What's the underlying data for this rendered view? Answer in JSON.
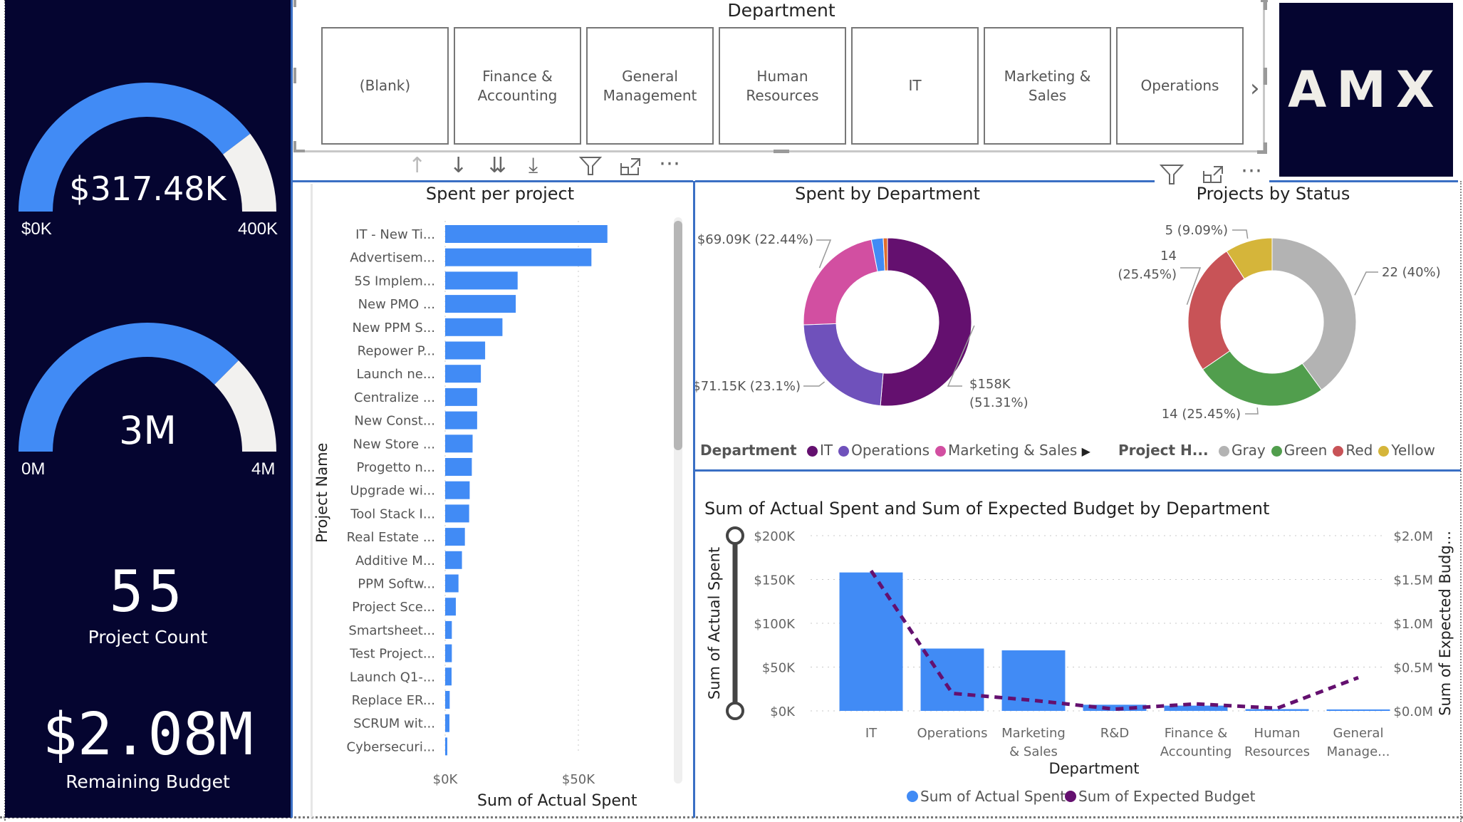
{
  "kpis": {
    "gauge_spent": {
      "value_label": "$317.48K",
      "min_label": "$0K",
      "max_label": "400K",
      "value": 317.48,
      "min": 0,
      "max": 400,
      "fill_color": "#418bf5",
      "track_color": "#f2f1ef"
    },
    "gauge_budget": {
      "value_label": "3M",
      "min_label": "0M",
      "max_label": "4M",
      "value": 3,
      "min": 0,
      "max": 4,
      "fill_color": "#418bf5",
      "track_color": "#f2f1ef"
    },
    "project_count": {
      "value": "55",
      "label": "Project Count"
    },
    "remaining_budget": {
      "value": "$2.08M",
      "label": "Remaining Budget"
    }
  },
  "slicer": {
    "title": "Department",
    "tiles": [
      "(Blank)",
      "Finance & Accounting",
      "General Management",
      "Human Resources",
      "IT",
      "Marketing & Sales",
      "Operations"
    ],
    "next_icon": "chevron-right-icon"
  },
  "visual_header_icons": {
    "drill_up": "↑",
    "drill_down": "↓",
    "expand_all": "⇊",
    "expand_next": "⤓",
    "filter": "⛛",
    "focus": "⤢",
    "more": "⋯"
  },
  "logo": {
    "text": "AMX"
  },
  "chart_data": [
    {
      "type": "bar",
      "orientation": "horizontal",
      "title": "Spent per project",
      "xlabel": "Sum of Actual Spent",
      "ylabel": "Project Name",
      "xlim": [
        0,
        75000
      ],
      "xticks": [
        {
          "value": 0,
          "label": "$0K"
        },
        {
          "value": 50000,
          "label": "$50K"
        }
      ],
      "grid": true,
      "color": "#418bf5",
      "categories": [
        "IT - New Ti...",
        "Advertisem...",
        "5S Implem...",
        "New PMO ...",
        "New PPM S...",
        "Repower P...",
        "Launch ne...",
        "Centralize ...",
        "New Const...",
        "New Store ...",
        "Progetto n...",
        "Upgrade wi...",
        "Tool Stack I...",
        "Real Estate ...",
        "Additive M...",
        "PPM Softw...",
        "Project Sce...",
        "Smartsheet...",
        "Test Project...",
        "Launch Q1-...",
        "Replace ER...",
        "SCRUM wit...",
        "Cybersecuri..."
      ],
      "values": [
        60900,
        54900,
        27200,
        26500,
        21500,
        15000,
        13400,
        12000,
        12000,
        10300,
        10000,
        9200,
        9000,
        7400,
        6300,
        5000,
        4000,
        2500,
        2500,
        2400,
        1700,
        1600,
        800
      ]
    },
    {
      "type": "pie",
      "donut": true,
      "title": "Spent by Department",
      "legend_title": "Department",
      "legend_position": "bottom-left",
      "slices": [
        {
          "name": "IT",
          "value": 158000,
          "percent": 51.31,
          "label": "$158K (51.31%)",
          "color": "#64106f"
        },
        {
          "name": "Operations",
          "value": 71150,
          "percent": 23.1,
          "label": "$71.15K (23.1%)",
          "color": "#6f51bb"
        },
        {
          "name": "Marketing & Sales",
          "value": 69090,
          "percent": 22.44,
          "label": "$69.09K (22.44%)",
          "color": "#d24fa1"
        },
        {
          "name": "R&D",
          "value": 7000,
          "percent": 2.3,
          "label": "",
          "color": "#418bf5"
        },
        {
          "name": "Finance & Accounting",
          "value": 2500,
          "percent": 0.85,
          "label": "",
          "color": "#e06c2c"
        }
      ],
      "legend_items": [
        "IT",
        "Operations",
        "Marketing & Sales"
      ]
    },
    {
      "type": "pie",
      "donut": true,
      "title": "Projects by Status",
      "legend_title": "Project H...",
      "legend_position": "bottom-left",
      "slices": [
        {
          "name": "Gray",
          "value": 22,
          "percent": 40,
          "label": "22 (40%)",
          "color": "#b3b3b3"
        },
        {
          "name": "Green",
          "value": 14,
          "percent": 25.45,
          "label": "14 (25.45%)",
          "color": "#519e4d"
        },
        {
          "name": "Red",
          "value": 14,
          "percent": 25.45,
          "label": "14 (25.45%)",
          "color": "#c85357"
        },
        {
          "name": "Yellow",
          "value": 5,
          "percent": 9.09,
          "label": "5 (9.09%)",
          "color": "#d5b53a"
        }
      ],
      "legend_items": [
        "Gray",
        "Green",
        "Red",
        "Yellow"
      ]
    },
    {
      "type": "bar",
      "combo": "bar+line",
      "title": "Sum of Actual Spent and Sum of Expected Budget by Department",
      "xlabel": "Department",
      "ylabel": "Sum of Actual Spent",
      "y2label": "Sum of Expected Budg...",
      "ylim": [
        0,
        200000
      ],
      "y2lim": [
        0,
        2000000
      ],
      "yticks": [
        "$0K",
        "$50K",
        "$100K",
        "$150K",
        "$200K"
      ],
      "y2ticks": [
        "$0.0M",
        "$0.5M",
        "$1.0M",
        "$1.5M",
        "$2.0M"
      ],
      "grid": true,
      "categories": [
        "IT",
        "Operations",
        "Marketing & Sales",
        "R&D",
        "Finance & Accounting",
        "Human Resources",
        "General Manage..."
      ],
      "series": [
        {
          "name": "Sum of Actual Spent",
          "type": "bar",
          "color": "#418bf5",
          "values": [
            158000,
            71150,
            69090,
            7000,
            6000,
            2000,
            1000
          ]
        },
        {
          "name": "Sum of Expected Budget",
          "type": "line",
          "style": "dashed",
          "color": "#64106f",
          "values": [
            1600000,
            200000,
            120000,
            20000,
            80000,
            30000,
            380000
          ]
        }
      ],
      "legend_position": "bottom"
    }
  ]
}
